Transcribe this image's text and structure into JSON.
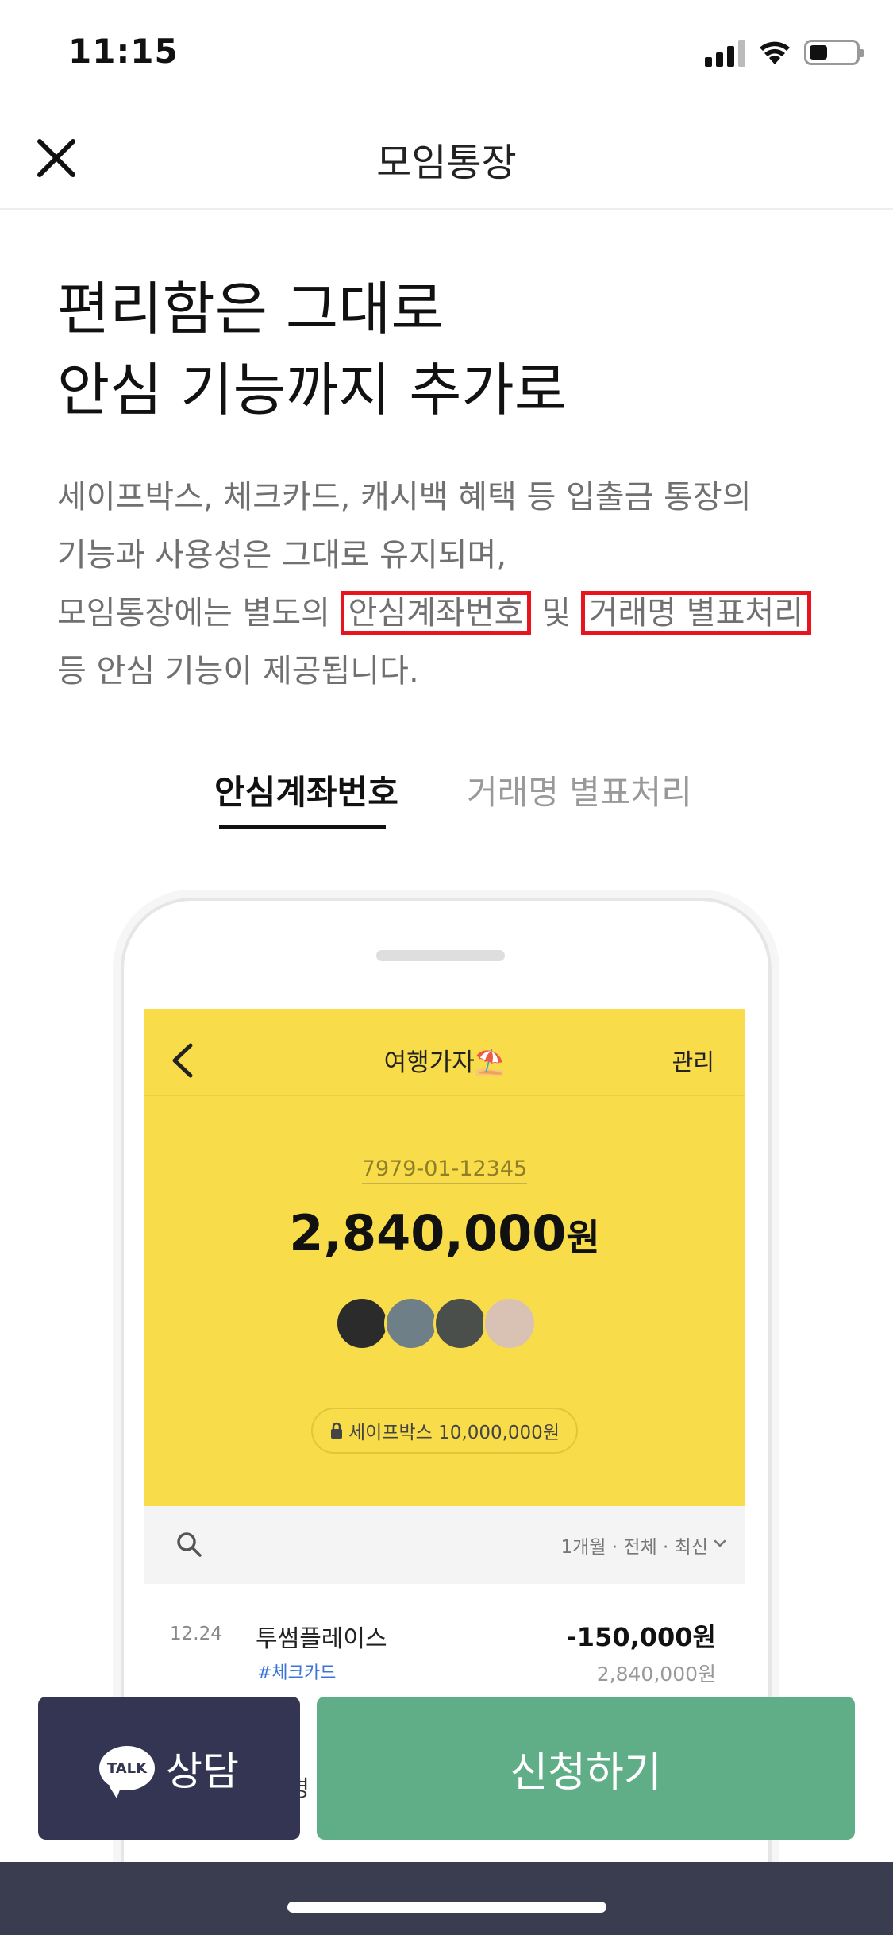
{
  "status_bar": {
    "time": "11:15"
  },
  "nav": {
    "title": "모임통장"
  },
  "headline": {
    "line1": "편리함은 그대로",
    "line2": "안심 기능까지 추가로"
  },
  "description": {
    "part1": "세이프박스, 체크카드, 캐시백 혜택 등 입출금 통장의 기능과 사용성은 그대로 유지되며,",
    "part2": "모임통장에는 별도의 ",
    "highlight1": "안심계좌번호",
    "part3": " 및 ",
    "highlight2": "거래명 별표처리",
    "part4": "등 안심 기능이 제공됩니다."
  },
  "tabs": [
    {
      "label": "안심계좌번호",
      "active": true
    },
    {
      "label": "거래명 별표처리",
      "active": false
    }
  ],
  "mock_screen": {
    "title": "여행가자⛱️",
    "manage": "관리",
    "account_number": "7979-01-12345",
    "balance_value": "2,840,000",
    "balance_unit": "원",
    "avatar_colors": [
      "#2b2b2b",
      "#6f7f88",
      "#4a4f4c",
      "#d9c2b4"
    ],
    "safebox": "세이프박스 10,000,000원",
    "filter": "1개월 · 전체 · 최신",
    "transaction": {
      "date": "12.24",
      "name": "투썸플레이스",
      "tag": "#체크카드",
      "amount": "-150,000원",
      "balance": "2,840,000원"
    },
    "partial_text": "명"
  },
  "buttons": {
    "talk_icon_text": "TALK",
    "talk": "상담",
    "apply": "신청하기"
  },
  "colors": {
    "yellow": "#f8dc49",
    "talk_button": "#333552",
    "apply_button": "#5fae87",
    "highlight_border": "#e8141e"
  }
}
